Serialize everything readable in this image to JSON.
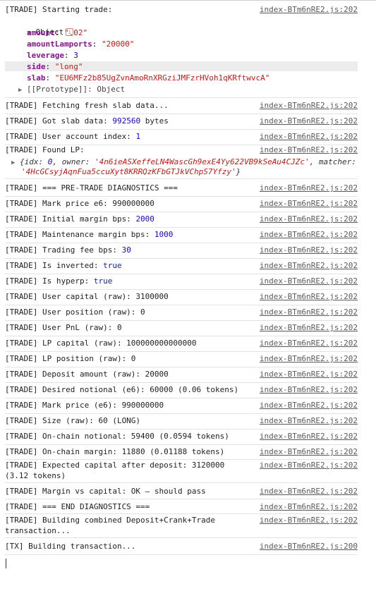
{
  "rows": [
    {
      "text": "[TRADE] Starting trade:",
      "src": "index-BTm6nRE2.js:202"
    },
    {
      "text": "[TRADE] Fetching fresh slab data...",
      "src": "index-BTm6nRE2.js:202"
    },
    {
      "text": "[TRADE] Got slab data: ",
      "val": "992560",
      "tail": " bytes",
      "src": "index-BTm6nRE2.js:202"
    },
    {
      "text": "[TRADE] User account index: ",
      "val": "1",
      "src": "index-BTm6nRE2.js:202"
    },
    {
      "text": "[TRADE] Found LP:",
      "src": "index-BTm6nRE2.js:202"
    },
    {
      "text": "[TRADE] === PRE-TRADE DIAGNOSTICS ===",
      "src": "index-BTm6nRE2.js:202"
    },
    {
      "text": "[TRADE] Mark price e6: 990000000",
      "src": "index-BTm6nRE2.js:202"
    },
    {
      "text": "[TRADE] Initial margin bps: ",
      "val": "2000",
      "src": "index-BTm6nRE2.js:202"
    },
    {
      "text": "[TRADE] Maintenance margin bps: ",
      "val": "1000",
      "src": "index-BTm6nRE2.js:202"
    },
    {
      "text": "[TRADE] Trading fee bps: ",
      "val": "30",
      "src": "index-BTm6nRE2.js:202"
    },
    {
      "text": "[TRADE] Is inverted: ",
      "kw": "true",
      "src": "index-BTm6nRE2.js:202"
    },
    {
      "text": "[TRADE] Is hyperp: ",
      "kw": "true",
      "src": "index-BTm6nRE2.js:202"
    },
    {
      "text": "[TRADE] User capital (raw): 3100000",
      "src": "index-BTm6nRE2.js:202"
    },
    {
      "text": "[TRADE] User position (raw): 0",
      "src": "index-BTm6nRE2.js:202"
    },
    {
      "text": "[TRADE] User PnL (raw): 0",
      "src": "index-BTm6nRE2.js:202"
    },
    {
      "text": "[TRADE] LP capital (raw): 100000000000000",
      "src": "index-BTm6nRE2.js:202"
    },
    {
      "text": "[TRADE] LP position (raw): 0",
      "src": "index-BTm6nRE2.js:202"
    },
    {
      "text": "[TRADE] Deposit amount (raw): 20000",
      "src": "index-BTm6nRE2.js:202"
    },
    {
      "text": "[TRADE] Desired notional (e6): 60000 (0.06 tokens)",
      "src": "index-BTm6nRE2.js:202"
    },
    {
      "text": "[TRADE] Mark price (e6): 990000000",
      "src": "index-BTm6nRE2.js:202"
    },
    {
      "text": "[TRADE] Size (raw): 60 (LONG)",
      "src": "index-BTm6nRE2.js:202"
    },
    {
      "text": "[TRADE] On-chain notional: 59400 (0.0594 tokens)",
      "src": "index-BTm6nRE2.js:202"
    },
    {
      "text": "[TRADE] On-chain margin: 11880 (0.01188 tokens)",
      "src": "index-BTm6nRE2.js:202"
    },
    {
      "text": "[TRADE] Expected capital after deposit: 3120000 (3.12 tokens)",
      "src": "index-BTm6nRE2.js:202"
    },
    {
      "text": "[TRADE] Margin vs capital: OK — should pass",
      "src": "index-BTm6nRE2.js:202"
    },
    {
      "text": "[TRADE] === END DIAGNOSTICS ===",
      "src": "index-BTm6nRE2.js:202"
    },
    {
      "text": "[TRADE] Building combined Deposit+Crank+Trade transaction...",
      "src": "index-BTm6nRE2.js:202"
    },
    {
      "text": "[TX] Building transaction...",
      "src": "index-BTm6nRE2.js:200"
    }
  ],
  "object": {
    "label": "Object",
    "info": "i",
    "props": [
      {
        "key": "amount",
        "sep": ": ",
        "val": "\".02\""
      },
      {
        "key": "amountLamports",
        "sep": ": ",
        "val": "\"20000\""
      },
      {
        "key": "leverage",
        "sep": ": ",
        "val": "3"
      },
      {
        "key": "side",
        "sep": ": ",
        "val": "\"long\""
      },
      {
        "key": "slab",
        "sep": ": ",
        "val": "\"EU6MFz2b85UgZvnAmoRnXRGziJMFzrHVoh1qKRftwvcA\""
      }
    ],
    "prototype": "[[Prototype]]: Object"
  },
  "lp": {
    "line1_a": "{idx: ",
    "idx": "0",
    "line1_b": ", owner: ",
    "owner": "'4n6ieASXeffeLN4WascGh9exE4Yy622VB9kSeAu4CJZc'",
    "line1_c": ", matcher:",
    "matcher": "'4HcGCsyjAqnFua5ccuXyt8KRRQzKFbGTJkVChpS7Yfzy'",
    "line2_tail": "}"
  }
}
